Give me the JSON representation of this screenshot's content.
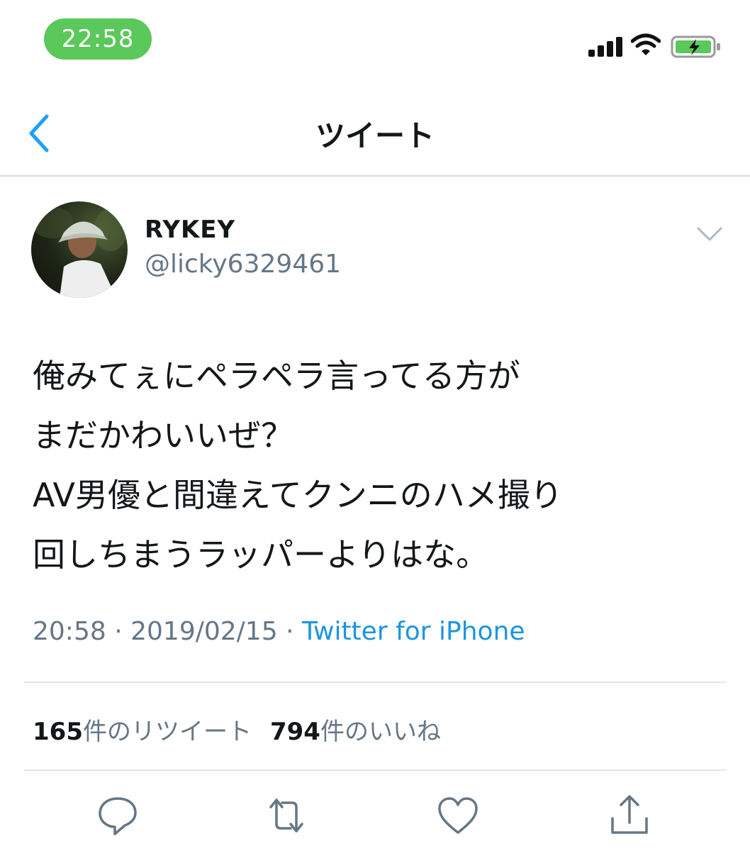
{
  "status_bar": {
    "time": "22:58",
    "signal_bars": 4,
    "battery_charging": true,
    "accent_color": "#5ac85a"
  },
  "nav": {
    "back_icon": "chevron-left-icon",
    "title": "ツイート"
  },
  "author": {
    "display_name": "RYKEY",
    "handle": "@licky6329461",
    "menu_icon": "chevron-down-icon"
  },
  "tweet": {
    "text": "俺みてぇにペラペラ言ってる方が\nまだかわいいぜ？\nAV男優と間違えてクンニのハメ撮り\n回しちまうラッパーよりはな。",
    "time": "20:58",
    "date": "2019/02/15",
    "separator": "·",
    "source": "Twitter for iPhone"
  },
  "stats": {
    "retweets_count": "165",
    "retweets_label": "件のリツイート",
    "likes_count": "794",
    "likes_label": "件のいいね"
  },
  "actions": [
    {
      "icon": "reply-icon"
    },
    {
      "icon": "retweet-icon"
    },
    {
      "icon": "like-icon"
    },
    {
      "icon": "share-icon"
    }
  ],
  "colors": {
    "link": "#1b95e0",
    "secondary_text": "#657786",
    "icon": "#657786",
    "back_arrow": "#1da1f2"
  }
}
